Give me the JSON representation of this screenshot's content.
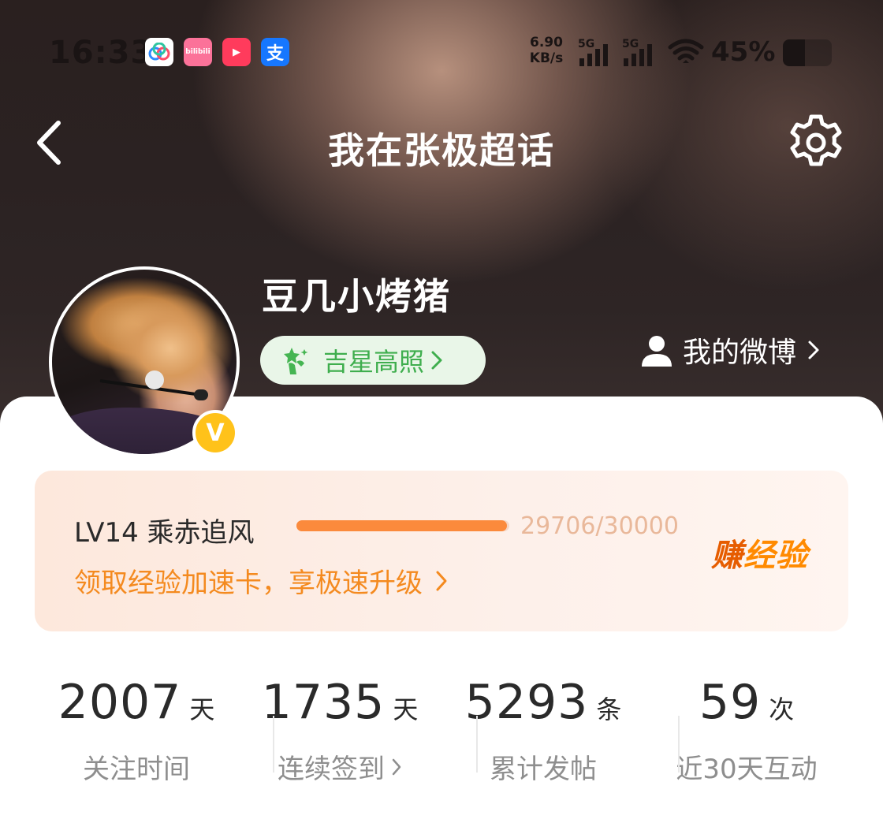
{
  "status_bar": {
    "time": "16:33",
    "net_speed_value": "6.90",
    "net_speed_unit": "KB/s",
    "signal_1": "5G",
    "signal_2": "5G",
    "battery_percent": "45%",
    "battery_level": 0.45,
    "app_icons": [
      "baidu-netdisk-icon",
      "bilibili-icon",
      "video-app-icon",
      "alipay-icon"
    ],
    "app_icon_glyphs": [
      "",
      "bilibili",
      "▶",
      "支"
    ]
  },
  "nav": {
    "title": "我在张极超话"
  },
  "profile": {
    "username": "豆几小烤猪",
    "honor_label": "吉星高照",
    "my_weibo_label": "我的微博",
    "verified_glyph": "V"
  },
  "level": {
    "name": "LV14 乘赤追风",
    "progress_current": 29706,
    "progress_max": 30000,
    "progress_text": "29706/30000",
    "promo_text": "领取经验加速卡，享极速升级",
    "earn_label_a": "赚",
    "earn_label_b": "经验"
  },
  "stats": [
    {
      "value": "2007",
      "unit": "天",
      "caption": "关注时间"
    },
    {
      "value": "1735",
      "unit": "天",
      "caption": "连续签到"
    },
    {
      "value": "5293",
      "unit": "条",
      "caption": "累计发帖"
    },
    {
      "value": "59",
      "unit": "次",
      "caption": "近30天互动"
    }
  ],
  "colors": {
    "accent_orange": "#f48a1f",
    "progress_fill": "#fb8a3c",
    "honor_green": "#3fae4e",
    "verified_yellow": "#ffc21a"
  }
}
